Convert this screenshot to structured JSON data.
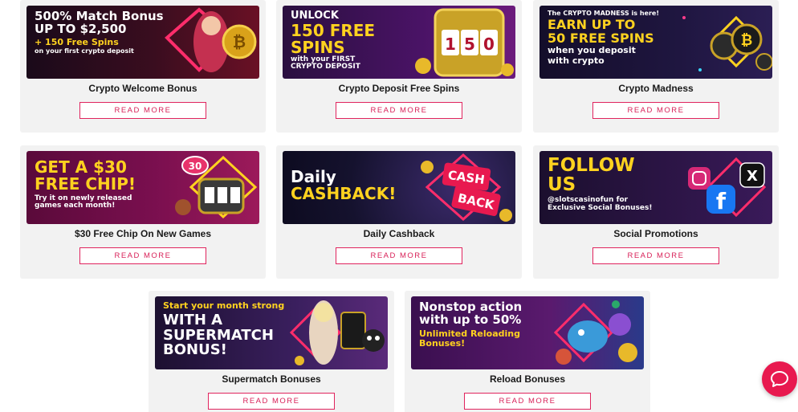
{
  "read_more_label": "READ MORE",
  "accent_color": "#e0245e",
  "cards": [
    {
      "title": "Crypto Welcome Bonus",
      "lines": [
        "500% Match Bonus",
        "UP TO $2,500",
        "+ 150 Free Spins",
        "on your first crypto deposit"
      ],
      "icon": "bitcoin-coin-icon"
    },
    {
      "title": "Crypto Deposit Free Spins",
      "lines": [
        "UNLOCK",
        "150 FREE",
        "SPINS",
        "with your FIRST",
        "CRYPTO DEPOSIT"
      ],
      "icon": "slot-machine-icon",
      "slot_digits": [
        "1",
        "5",
        "0"
      ]
    },
    {
      "title": "Crypto Madness",
      "lines": [
        "The CRYPTO MADNESS is here!",
        "EARN UP TO",
        "50 FREE SPINS",
        "when you deposit",
        "with crypto"
      ],
      "icon": "crypto-coins-icon"
    },
    {
      "title": "$30 Free Chip On New Games",
      "lines": [
        "GET A $30",
        "FREE CHIP!",
        "Try it on newly released",
        "games each month!"
      ],
      "icon": "casino-chip-icon",
      "chip_value": "30"
    },
    {
      "title": "Daily Cashback",
      "lines": [
        "Daily",
        "CASHBACK!"
      ],
      "icon": "cashback-sign-icon",
      "sign_lines": [
        "CASH",
        "BACK"
      ]
    },
    {
      "title": "Social Promotions",
      "lines": [
        "FOLLOW",
        "US",
        "@slotscasinofun for",
        "Exclusive Social Bonuses!"
      ],
      "icon": "social-media-icons"
    },
    {
      "title": "Supermatch Bonuses",
      "lines": [
        "Start your month strong",
        "WITH A",
        "SUPERMATCH",
        "BONUS!"
      ],
      "icon": "character-icon"
    },
    {
      "title": "Reload Bonuses",
      "lines": [
        "Nonstop action",
        "with up to 50%",
        "Unlimited Reloading",
        "Bonuses!"
      ],
      "icon": "game-characters-icon"
    }
  ],
  "chat_icon": "chat-bubble-icon"
}
